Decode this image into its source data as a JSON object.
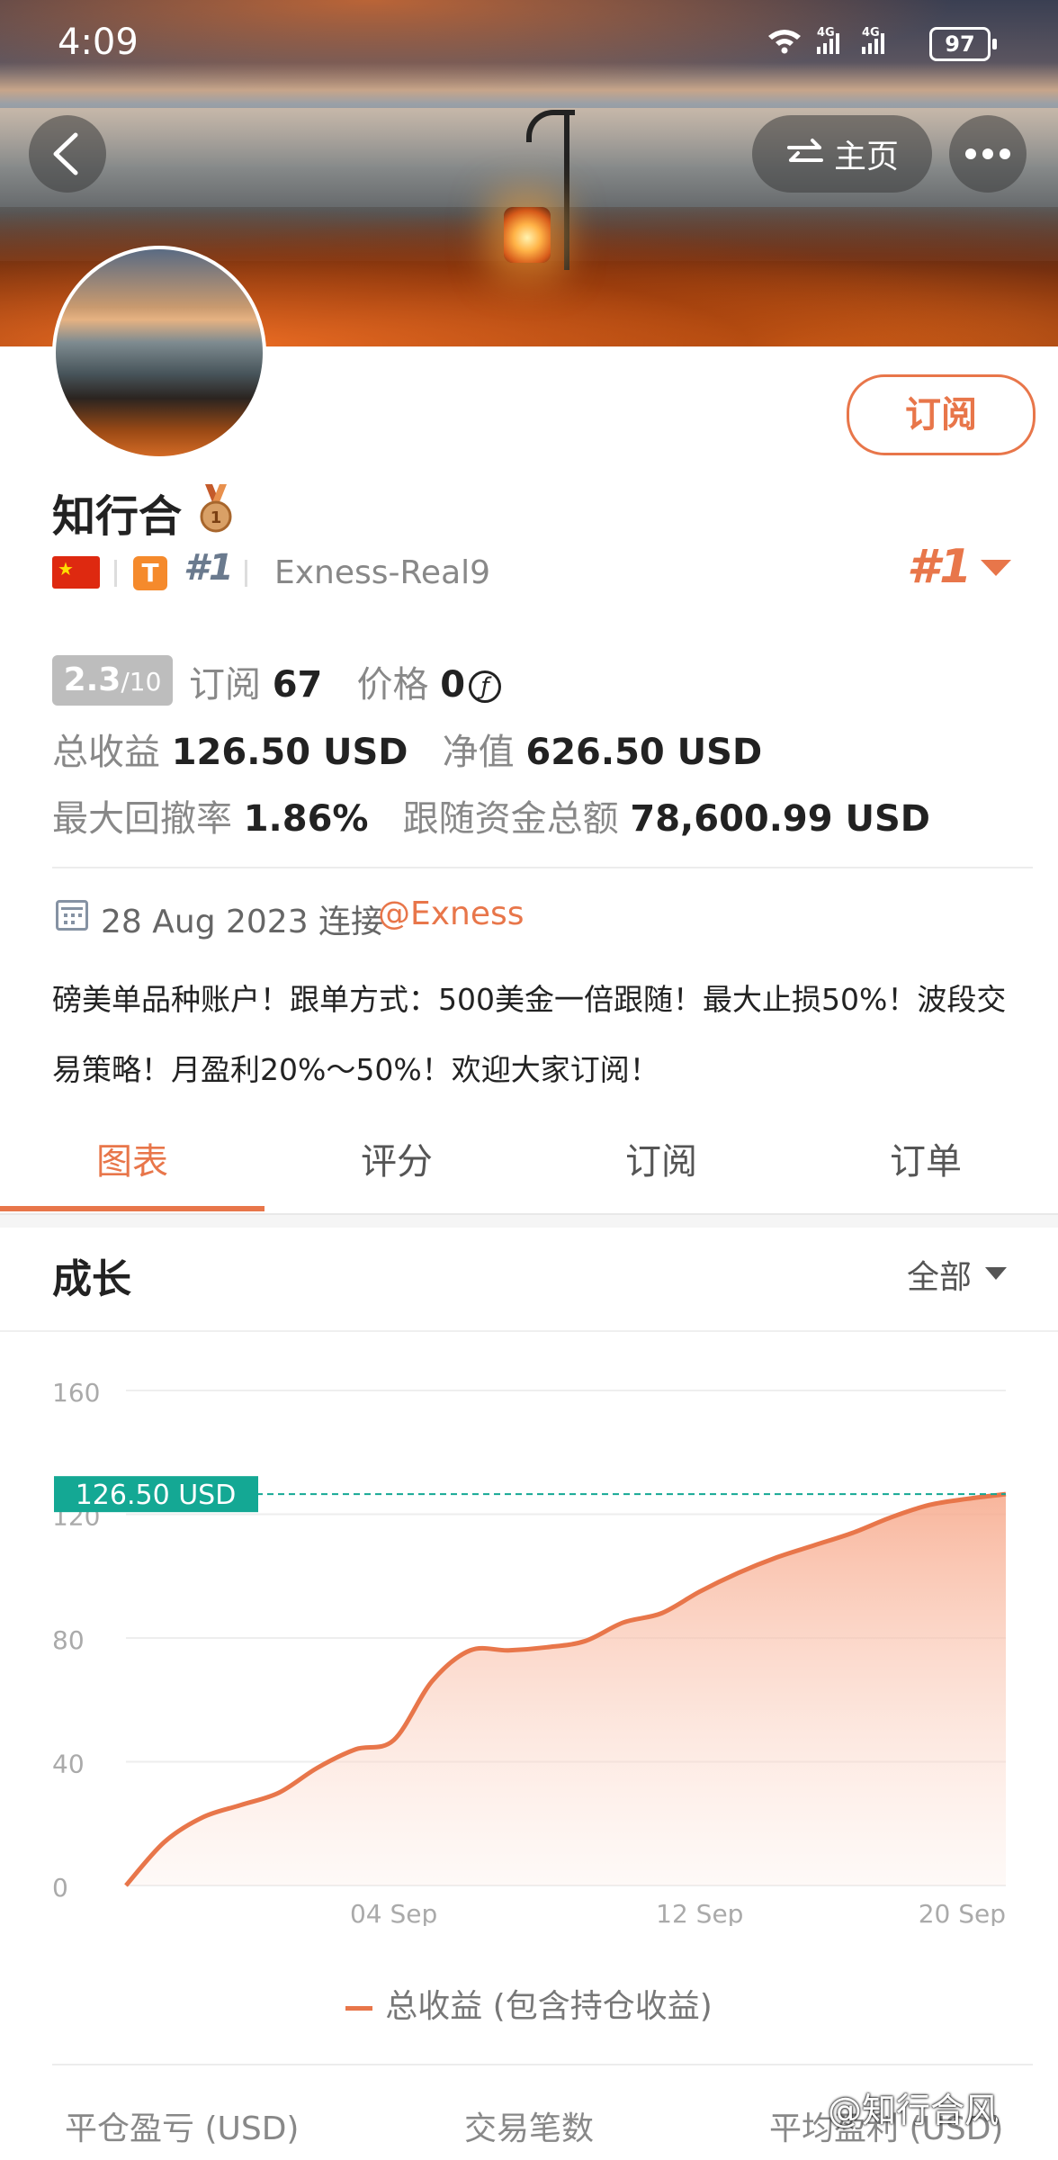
{
  "status_bar": {
    "time": "4:09",
    "network": "4G 4G",
    "battery": "97"
  },
  "header": {
    "home_label": "主页",
    "subscribe_label": "订阅"
  },
  "profile": {
    "name": "知行合",
    "rank": "#1",
    "server": "Exness-Real9",
    "rank_right": "#1",
    "t_badge": "T"
  },
  "stats": {
    "score": "2.3",
    "score_max": "/10",
    "subscribe_label": "订阅",
    "subscribe_count": "67",
    "price_label": "价格",
    "price_value": "0",
    "coin_symbol": "ƒ",
    "total_profit_label": "总收益",
    "total_profit_value": "126.50 USD",
    "equity_label": "净值",
    "equity_value": "626.50 USD",
    "drawdown_label": "最大回撤率",
    "drawdown_value": "1.86%",
    "follow_funds_label": "跟随资金总额",
    "follow_funds_value": "78,600.99 USD"
  },
  "connection": {
    "date": "28 Aug 2023 连接",
    "broker": "@Exness"
  },
  "description": "磅美单品种账户！跟单方式：500美金一倍跟随！最大止损50%！波段交易策略！月盈利20%～50%！欢迎大家订阅！",
  "tabs": [
    "图表",
    "评分",
    "订阅",
    "订单"
  ],
  "section": {
    "title": "成长",
    "filter": "全部"
  },
  "chart_data": {
    "type": "area",
    "x": [
      "28 Aug",
      "29 Aug",
      "30 Aug",
      "31 Aug",
      "01 Sep",
      "02 Sep",
      "03 Sep",
      "04 Sep",
      "05 Sep",
      "06 Sep",
      "07 Sep",
      "08 Sep",
      "09 Sep",
      "10 Sep",
      "11 Sep",
      "12 Sep",
      "13 Sep",
      "14 Sep",
      "15 Sep",
      "16 Sep",
      "17 Sep",
      "18 Sep",
      "19 Sep",
      "20 Sep"
    ],
    "series": [
      {
        "name": "总收益 (包含持仓收益)",
        "values": [
          0,
          14,
          22,
          26,
          30,
          38,
          44,
          47,
          66,
          76,
          76,
          77,
          79,
          85,
          88,
          95,
          101,
          106,
          110,
          114,
          119,
          123,
          125,
          126.5
        ]
      }
    ],
    "x_ticks": [
      "04 Sep",
      "12 Sep",
      "20 Sep"
    ],
    "y_ticks": [
      0,
      40,
      80,
      120,
      160
    ],
    "ylim": [
      0,
      160
    ],
    "current_label": "126.50 USD",
    "current_value": 126.5,
    "grid": true,
    "colors": {
      "line": "#e8764a",
      "fill_top": "#f7b9a0",
      "marker": "#14a894"
    }
  },
  "legend": {
    "label": "总收益 (包含持仓收益)"
  },
  "bottom_labels": [
    "平仓盈亏 (USD)",
    "交易笔数",
    "平均盈利 (USD)"
  ],
  "watermark": "@知行合风"
}
